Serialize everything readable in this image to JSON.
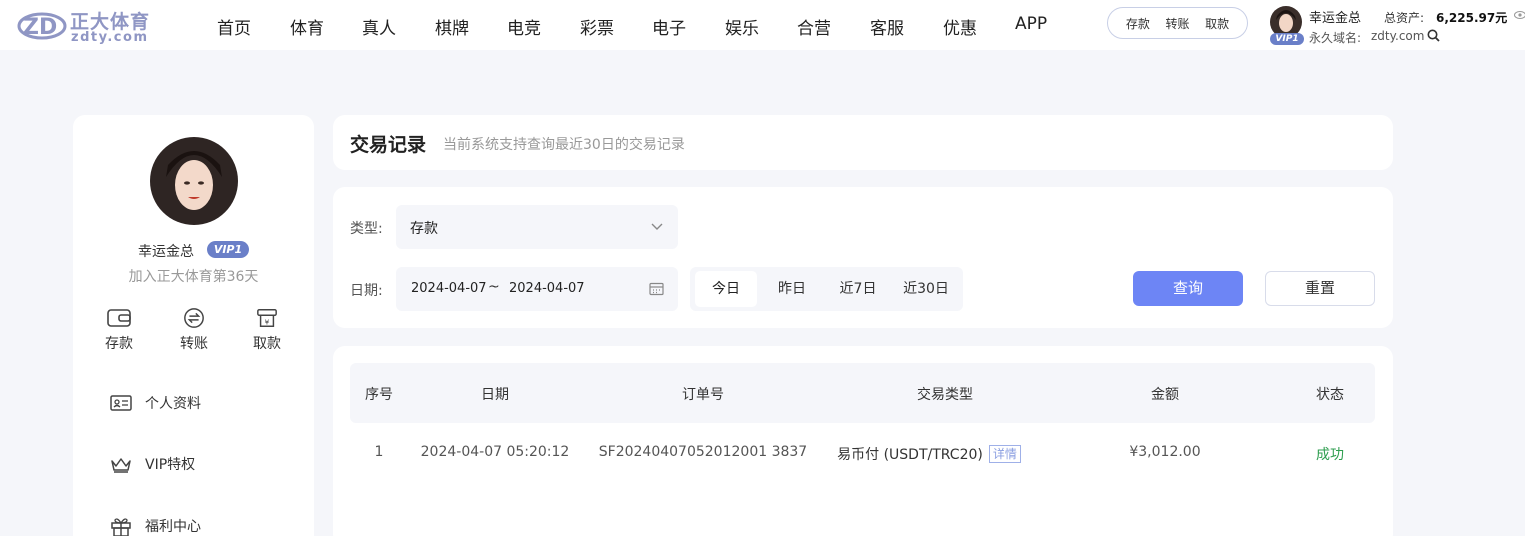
{
  "brand": {
    "name_cn": "正大体育",
    "name_en": "zdty.com"
  },
  "nav": [
    "首页",
    "体育",
    "真人",
    "棋牌",
    "电竞",
    "彩票",
    "电子",
    "娱乐",
    "合营",
    "客服",
    "优惠",
    "APP"
  ],
  "header_actions": {
    "deposit": "存款",
    "transfer": "转账",
    "withdraw": "取款"
  },
  "header_user": {
    "username": "幸运金总",
    "vip": "VIP1",
    "assets_label": "总资产:",
    "assets_value": "6,225.97元",
    "domain_label": "永久域名:",
    "domain_value": "zdty.com"
  },
  "sidebar": {
    "username": "幸运金总",
    "vip": "VIP1",
    "join_text": "加入正大体育第36天",
    "quick": {
      "deposit": "存款",
      "transfer": "转账",
      "withdraw": "取款"
    },
    "menu": [
      "个人资料",
      "VIP特权",
      "福利中心"
    ]
  },
  "page": {
    "title": "交易记录",
    "subtitle": "当前系统支持查询最近30日的交易记录"
  },
  "filters": {
    "type_label": "类型:",
    "type_value": "存款",
    "date_label": "日期:",
    "date_from": "2024-04-07",
    "date_separator": "~",
    "date_to": "2024-04-07",
    "ranges": [
      "今日",
      "昨日",
      "近7日",
      "近30日"
    ],
    "active_range": "今日",
    "query_button": "查询",
    "reset_button": "重置"
  },
  "table": {
    "columns": [
      "序号",
      "日期",
      "订单号",
      "交易类型",
      "金额",
      "状态"
    ],
    "rows": [
      {
        "index": "1",
        "date": "2024-04-07 05:20:12",
        "order_no": "SF20240407052012001 3837",
        "type": "易币付 (USDT/TRC20)",
        "detail": "详情",
        "amount": "¥3,012.00",
        "status": "成功"
      }
    ]
  },
  "colors": {
    "accent": "#6d85f5",
    "success": "#2e9e4f",
    "brand": "#8f96c4"
  }
}
